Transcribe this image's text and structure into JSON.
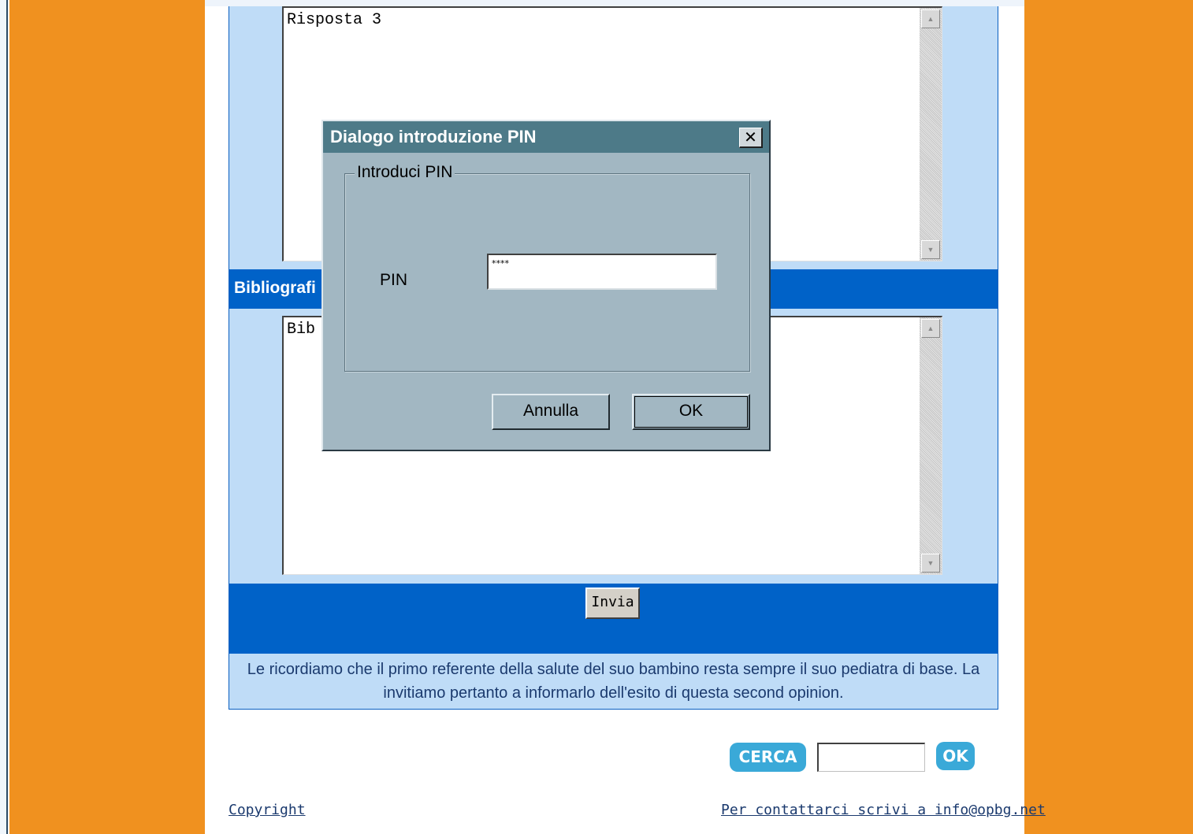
{
  "form": {
    "answer_text": "Risposta 3",
    "bibliography_section_title": "Bibliografi",
    "bibliography_text": "Bib",
    "submit_label": "Invia",
    "notice_text": "Le ricordiamo che il primo referente della salute del suo bambino resta sempre il suo pediatra di base. La invitiamo pertanto a informarlo dell'esito di questa second opinion."
  },
  "search": {
    "button_label": "CERCA",
    "input_value": "",
    "ok_label": "OK"
  },
  "footer": {
    "copyright_label": "Copyright",
    "contact_label": "Per contattarci scrivi a info@opbg.net"
  },
  "dialog": {
    "title": "Dialogo introduzione PIN",
    "close_glyph": "✕",
    "group_label": "Introduci PIN",
    "pin_label": "PIN",
    "pin_value": "****",
    "cancel_label": "Annulla",
    "ok_label": "OK"
  },
  "colors": {
    "orange_side": "#f0911f",
    "panel_light_blue": "#bfdcf7",
    "section_blue": "#0062c8",
    "dialog_gray_blue": "#a2b7c2",
    "dialog_title": "#4d7a88",
    "search_button": "#3aa9d8"
  },
  "icons": {
    "scroll_up": "scroll-up-arrow-icon",
    "scroll_down": "scroll-down-arrow-icon",
    "close": "close-icon"
  }
}
